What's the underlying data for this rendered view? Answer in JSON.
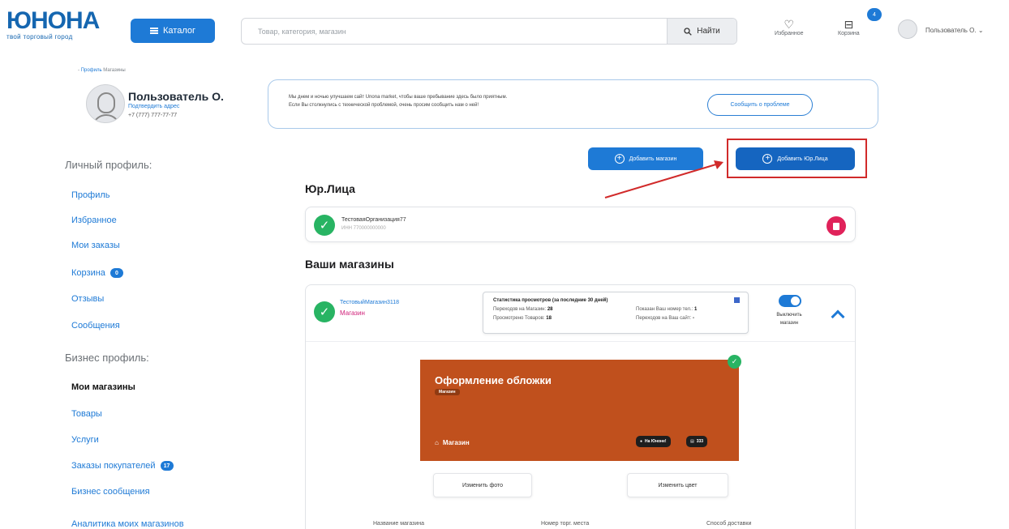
{
  "header": {
    "logo": "ЮНОНА",
    "logo_sub": "твой торговый город",
    "catalog_label": "Каталог",
    "search_placeholder": "Товар, категория, магазин",
    "search_btn": "Найти",
    "favorites_label": "Избранное",
    "cart_label": "Корзина",
    "cart_count": "4",
    "user_label": "Пользователь О."
  },
  "breadcrumb": {
    "link": "Профиль",
    "current": "Магазины"
  },
  "profile": {
    "name": "Пользователь О.",
    "link": "Подтвердить адрес",
    "phone": "+7 (777) 777-77-77"
  },
  "sidebar": {
    "personal_title": "Личный профиль:",
    "personal_items": [
      {
        "label": "Профиль"
      },
      {
        "label": "Избранное"
      },
      {
        "label": "Мои заказы"
      },
      {
        "label": "Корзина",
        "badge": "0"
      },
      {
        "label": "Отзывы"
      },
      {
        "label": "Сообщения"
      }
    ],
    "business_title": "Бизнес профиль:",
    "business_items": [
      {
        "label": "Мои магазины"
      },
      {
        "label": "Товары"
      },
      {
        "label": "Услуги"
      },
      {
        "label": "Заказы покупателей",
        "badge": "17"
      },
      {
        "label": "Бизнес сообщения"
      },
      {
        "label": "Аналитика моих магазинов"
      }
    ]
  },
  "notice": {
    "line1": "Мы днем и ночью улучшаем сайт Unona market, чтобы ваше пребывание здесь было приятным.",
    "line2": "Если Вы столкнулись с технической проблемой, очень просим сообщить нам о ней!",
    "button": "Сообщить о проблеме"
  },
  "actions": {
    "add_shop": "Добавить магазин",
    "add_legal": "Добавить Юр.Лица"
  },
  "legal": {
    "title": "Юр.Лица",
    "name": "ТестоваяОрганизация77",
    "inn": "ИНН 770000000000"
  },
  "shops": {
    "title": "Ваши магазины",
    "item": {
      "name": "ТестовыйМагазин3118",
      "type": "Магазин",
      "stats_title": "Статистика просмотров (за последние 30 дней)",
      "visits_label": "Переходов на Магазин:",
      "visits": "28",
      "products_label": "Просмотрено Товаров:",
      "products": "18",
      "phone_label": "Показан Ваш номер тел.:",
      "phone": "1",
      "site_label": "Переходов на Ваш сайт:",
      "site": "-",
      "toggle_label_1": "Выключить",
      "toggle_label_2": "магазин",
      "cover_title": "Оформление обложки",
      "cover_tag": "Магазин",
      "cover_type": "Магазин",
      "cover_pill_1": "На Юноне!",
      "cover_pill_2": "333",
      "edit_photo": "Изменить фото",
      "edit_color": "Изменить цвет",
      "field_1": "Название магазина",
      "field_2": "Номер торг. места",
      "field_3": "Способ доставки"
    }
  },
  "colors": {
    "brand": "#1566b0",
    "accent": "#1e7ad6",
    "cover": "#c0501d",
    "success": "#28b463",
    "danger": "#e0225a",
    "highlight": "#d12a2a"
  }
}
